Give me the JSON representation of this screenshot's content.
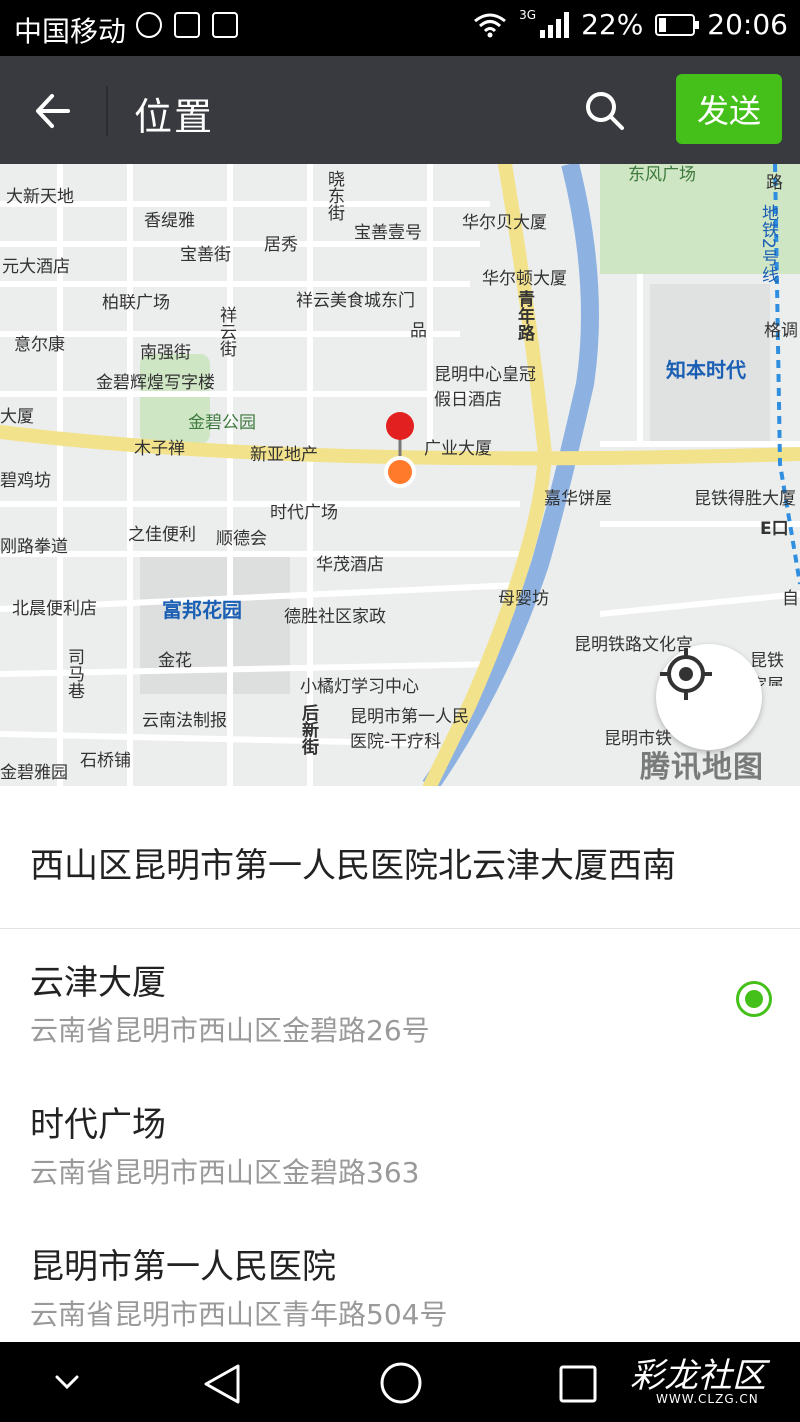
{
  "status_bar": {
    "carrier": "中国移动",
    "network": "3G",
    "battery": "22%",
    "battery_level": 0.22,
    "time": "20:06"
  },
  "header": {
    "title": "位置",
    "send_label": "发送",
    "accent": "#45c01a",
    "bar_color": "#393a3f"
  },
  "map": {
    "provider_watermark": "腾讯地图",
    "labels": [
      "大新天地",
      "香缇雅",
      "晓东街",
      "宝善壹号",
      "华尔贝大厦",
      "东风广场",
      "路",
      "元大酒店",
      "宝善街",
      "居秀",
      "地铁2号线",
      "华尔顿大厦",
      "柏联广场",
      "祥云美食城东门",
      "意尔康",
      "祥云街",
      "品",
      "青年路",
      "格调",
      "南强街",
      "知本时代",
      "金碧辉煌写字楼",
      "昆明中心皇冠假日酒店",
      "大厦",
      "金碧公园",
      "木子禅",
      "新亚地产",
      "广业大厦",
      "碧鸡坊",
      "时代广场",
      "嘉华饼屋",
      "昆铁得胜大厦",
      "E口",
      "之佳便利",
      "顺德会",
      "刚路拳道",
      "华茂酒店",
      "母婴坊",
      "北晨便利店",
      "富邦花园",
      "德胜社区家政",
      "自",
      "金花",
      "司马巷",
      "昆明铁路文化宫",
      "昆铁家属住宅小",
      "小橘灯学习中心",
      "云南法制报",
      "昆明市第一人民医院-干疗科",
      "后新街",
      "昆明市铁",
      "石桥铺",
      "金碧雅园"
    ]
  },
  "address_header": "西山区昆明市第一人民医院北云津大厦西南",
  "poi_list": [
    {
      "name": "云津大厦",
      "address": "云南省昆明市西山区金碧路26号",
      "selected": true
    },
    {
      "name": "时代广场",
      "address": "云南省昆明市西山区金碧路363",
      "selected": false
    },
    {
      "name": "昆明市第一人民医院",
      "address": "云南省昆明市西山区青年路504号",
      "selected": false
    }
  ],
  "watermark": {
    "text": "彩龙社区",
    "url": "WWW.CLZG.CN"
  }
}
